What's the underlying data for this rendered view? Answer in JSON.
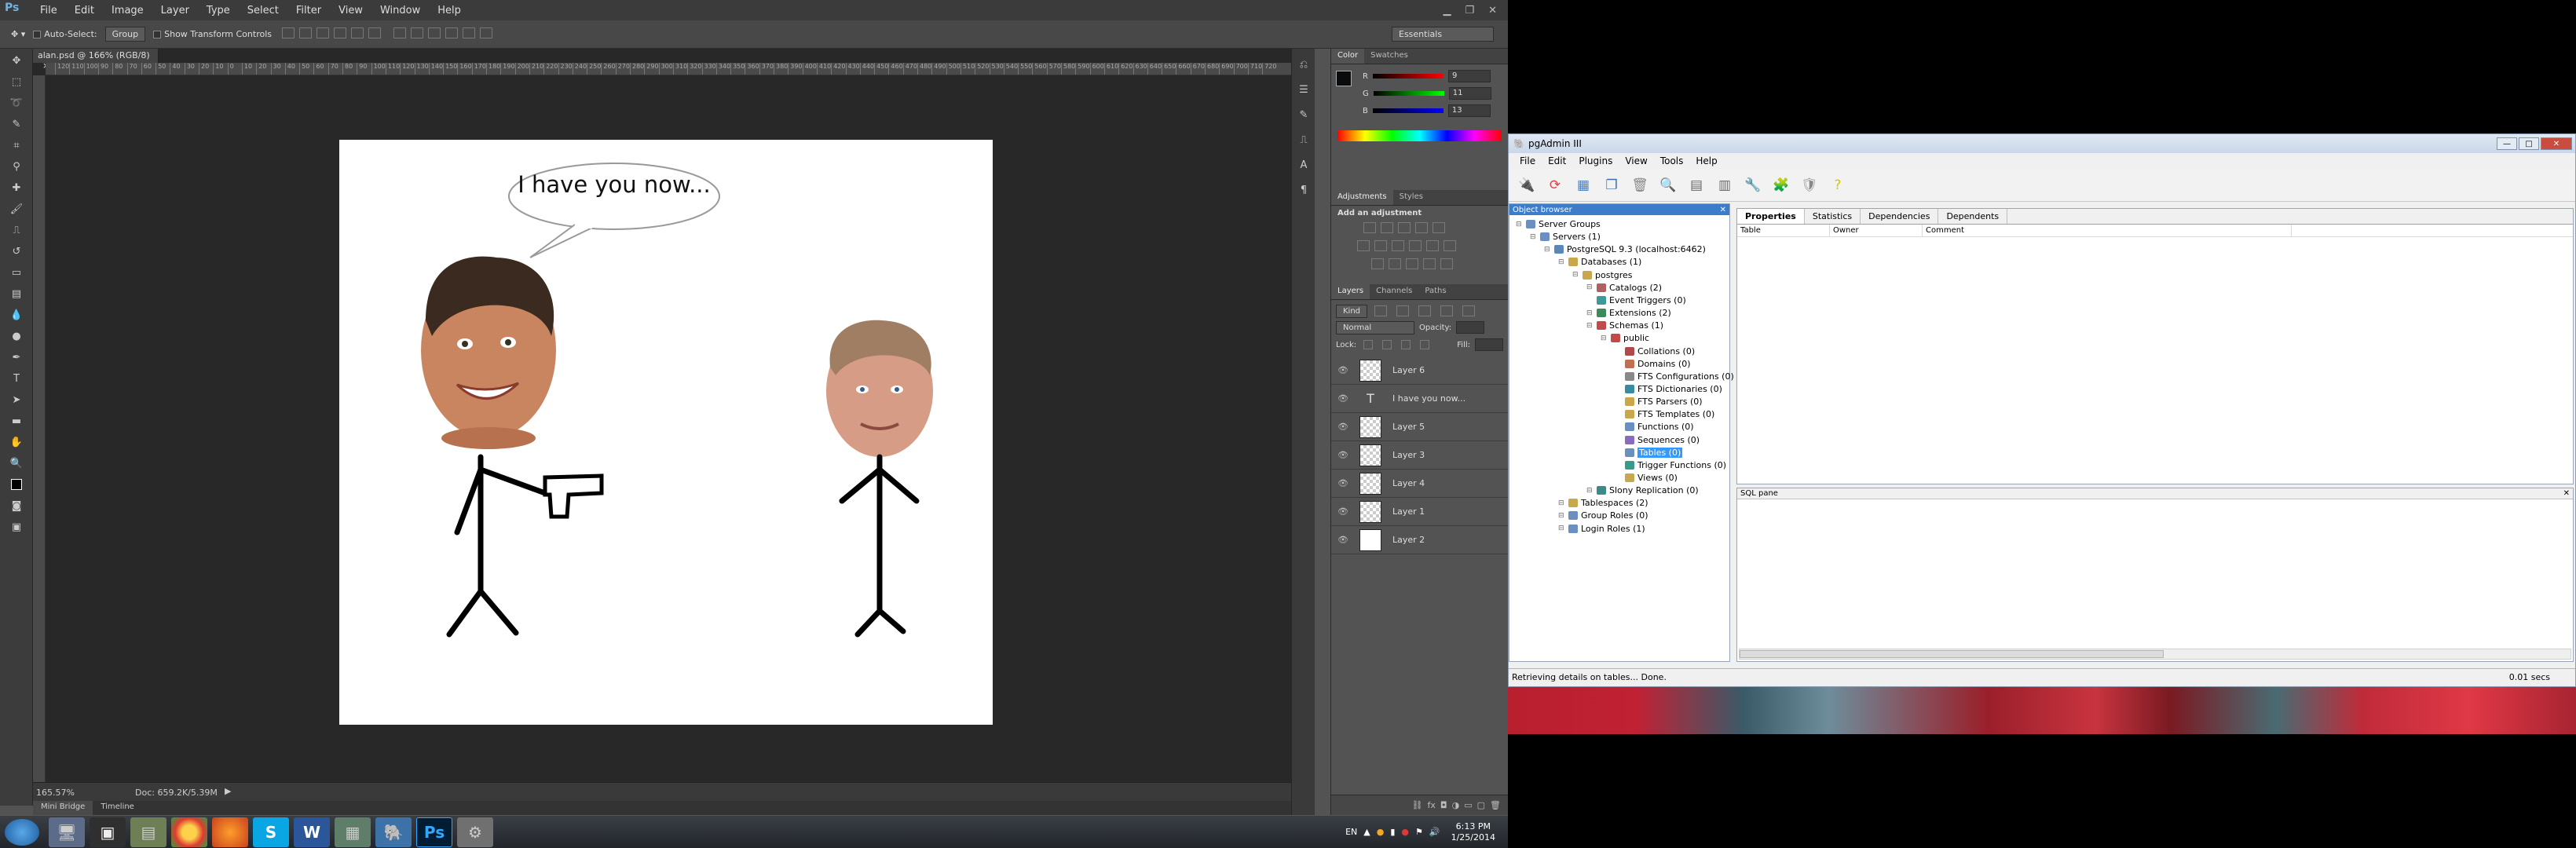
{
  "photoshop": {
    "app_logo": "Ps",
    "menu": [
      "File",
      "Edit",
      "Image",
      "Layer",
      "Type",
      "Select",
      "Filter",
      "View",
      "Window",
      "Help"
    ],
    "options": {
      "auto_select_label": "Auto-Select:",
      "auto_select_value": "Group",
      "show_transform_label": "Show Transform Controls",
      "workspace": "Essentials"
    },
    "document_tab": "alan.psd @ 166% (RGB/8)",
    "ruler_ticks": [
      "120",
      "110",
      "100",
      "90",
      "80",
      "70",
      "60",
      "50",
      "40",
      "30",
      "20",
      "10",
      "0",
      "10",
      "20",
      "30",
      "40",
      "50",
      "60",
      "70",
      "80",
      "90",
      "100",
      "110",
      "120",
      "130",
      "140",
      "150",
      "160",
      "170",
      "180",
      "190",
      "200",
      "210",
      "220",
      "230",
      "240",
      "250",
      "260",
      "270",
      "280",
      "290",
      "300",
      "310",
      "320",
      "330",
      "340",
      "350",
      "360",
      "370",
      "380",
      "390",
      "400",
      "410",
      "420",
      "430",
      "440",
      "450",
      "460",
      "470",
      "480",
      "490",
      "500",
      "510",
      "520",
      "530",
      "540",
      "550",
      "560",
      "570",
      "580",
      "590",
      "600",
      "610",
      "620",
      "630",
      "640",
      "650",
      "660",
      "670",
      "680",
      "690",
      "700",
      "710",
      "720"
    ],
    "speech_text": "I have you now...",
    "status": {
      "zoom": "165.57%",
      "doc": "Doc: 659.2K/5.39M"
    },
    "bottom_tabs": [
      "Mini Bridge",
      "Timeline"
    ],
    "color_panel": {
      "tabs": [
        "Color",
        "Swatches"
      ],
      "rows": [
        {
          "label": "R",
          "value": "9"
        },
        {
          "label": "G",
          "value": "11"
        },
        {
          "label": "B",
          "value": "13"
        }
      ]
    },
    "adjustments_panel": {
      "tabs": [
        "Adjustments",
        "Styles"
      ],
      "title": "Add an adjustment"
    },
    "layers_panel": {
      "tabs": [
        "Layers",
        "Channels",
        "Paths"
      ],
      "kind_label": "Kind",
      "blend_mode": "Normal",
      "opacity_label": "Opacity:",
      "lock_label": "Lock:",
      "fill_label": "Fill:",
      "layers": [
        "Layer 6",
        "I have you now...",
        "Layer 5",
        "Layer 3",
        "Layer 4",
        "Layer 1",
        "Layer 2"
      ]
    }
  },
  "pgadmin": {
    "title": "pgAdmin III",
    "menu": [
      "File",
      "Edit",
      "Plugins",
      "View",
      "Tools",
      "Help"
    ],
    "tree_title": "Object browser",
    "tree": [
      {
        "label": "Server Groups",
        "depth": 0
      },
      {
        "label": "Servers (1)",
        "depth": 1
      },
      {
        "label": "PostgreSQL 9.3 (localhost:6462)",
        "depth": 2
      },
      {
        "label": "Databases (1)",
        "depth": 3
      },
      {
        "label": "postgres",
        "depth": 4
      },
      {
        "label": "Catalogs (2)",
        "depth": 5
      },
      {
        "label": "Event Triggers (0)",
        "depth": 5
      },
      {
        "label": "Extensions (2)",
        "depth": 5
      },
      {
        "label": "Schemas (1)",
        "depth": 5
      },
      {
        "label": "public",
        "depth": 6
      },
      {
        "label": "Collations (0)",
        "depth": 7
      },
      {
        "label": "Domains (0)",
        "depth": 7
      },
      {
        "label": "FTS Configurations (0)",
        "depth": 7
      },
      {
        "label": "FTS Dictionaries (0)",
        "depth": 7
      },
      {
        "label": "FTS Parsers (0)",
        "depth": 7
      },
      {
        "label": "FTS Templates (0)",
        "depth": 7
      },
      {
        "label": "Functions (0)",
        "depth": 7
      },
      {
        "label": "Sequences (0)",
        "depth": 7
      },
      {
        "label": "Tables (0)",
        "depth": 7,
        "selected": true
      },
      {
        "label": "Trigger Functions (0)",
        "depth": 7
      },
      {
        "label": "Views (0)",
        "depth": 7
      },
      {
        "label": "Slony Replication (0)",
        "depth": 5
      },
      {
        "label": "Tablespaces (2)",
        "depth": 3
      },
      {
        "label": "Group Roles (0)",
        "depth": 3
      },
      {
        "label": "Login Roles (1)",
        "depth": 3
      }
    ],
    "props_tabs": [
      "Properties",
      "Statistics",
      "Dependencies",
      "Dependents"
    ],
    "columns": [
      "Table",
      "Owner",
      "Comment"
    ],
    "sql_pane_title": "SQL pane",
    "status_text": "Retrieving details on tables... Done.",
    "status_time": "0.01 secs"
  },
  "taskbar": {
    "language": "EN",
    "time": "6:13 PM",
    "date": "1/25/2014"
  }
}
